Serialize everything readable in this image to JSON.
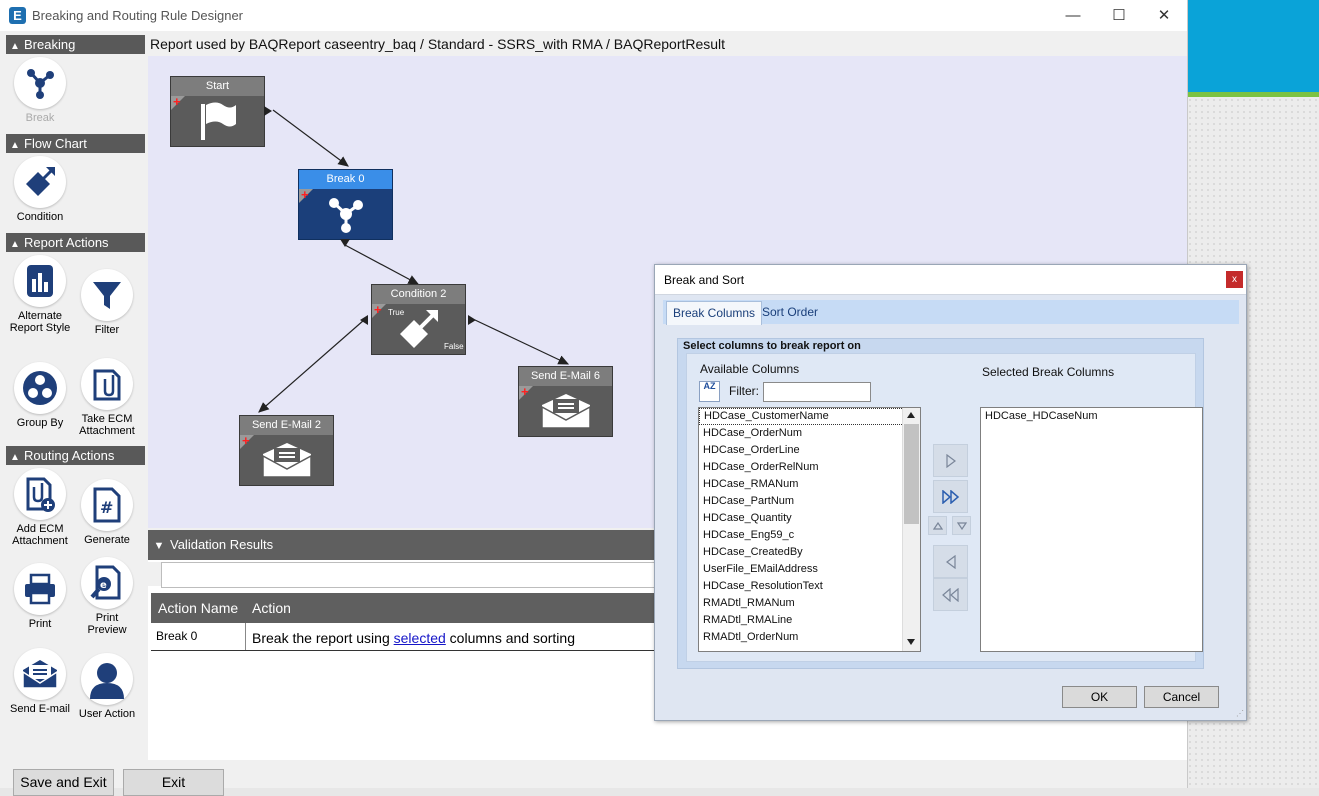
{
  "window": {
    "title": "Breaking and Routing Rule Designer",
    "app_icon": "E",
    "controls": {
      "minimize": "—",
      "maximize": "☐",
      "close": "✕"
    }
  },
  "palette": {
    "sections": [
      {
        "title": "Breaking",
        "tools": [
          {
            "label": "Break",
            "icon": "break-icon"
          }
        ]
      },
      {
        "title": "Flow Chart",
        "tools": [
          {
            "label": "Condition",
            "icon": "condition-icon"
          }
        ]
      },
      {
        "title": "Report Actions",
        "tools": [
          {
            "label": "Alternate Report Style",
            "icon": "report-style-icon"
          },
          {
            "label": "Filter",
            "icon": "filter-icon"
          },
          {
            "label": "Group By",
            "icon": "group-by-icon"
          },
          {
            "label": "Take ECM Attachment",
            "icon": "ecm-attachment-icon"
          }
        ]
      },
      {
        "title": "Routing Actions",
        "tools": [
          {
            "label": "Add ECM Attachment",
            "icon": "add-ecm-icon"
          },
          {
            "label": "Generate",
            "icon": "generate-icon"
          },
          {
            "label": "Print",
            "icon": "print-icon"
          },
          {
            "label": "Print Preview",
            "icon": "print-preview-icon"
          },
          {
            "label": "Send E-mail",
            "icon": "send-email-icon"
          },
          {
            "label": "User Action",
            "icon": "user-action-icon"
          }
        ]
      }
    ]
  },
  "header": {
    "report_line": "Report used by BAQReport caseentry_baq / Standard - SSRS_with RMA / BAQReportResult"
  },
  "flow": {
    "nodes": {
      "start": {
        "label": "Start"
      },
      "break0": {
        "label": "Break 0"
      },
      "condition2": {
        "label": "Condition 2",
        "true_label": "True",
        "false_label": "False"
      },
      "email2": {
        "label": "Send E-Mail 2"
      },
      "email6": {
        "label": "Send E-Mail 6"
      }
    },
    "colors": {
      "canvas": "#e6e6f7",
      "node": "#5b5b5b",
      "selected_node": "#1b3f7a",
      "selected_header": "#3a8ee8"
    }
  },
  "validation": {
    "title": "Validation Results",
    "columns": [
      "Action Name",
      "Action"
    ],
    "rows": [
      {
        "name": "Break 0",
        "pre": "Break the report using ",
        "link": "selected",
        "post": " columns and sorting"
      }
    ]
  },
  "footer": {
    "save_exit": "Save and Exit",
    "exit": "Exit"
  },
  "dialog": {
    "title": "Break and Sort",
    "close": "x",
    "tabs": [
      "Break Columns",
      "Sort Order"
    ],
    "active_tab": "Break Columns",
    "section_label": "Select columns to break report on",
    "available_label": "Available Columns",
    "filter_label": "Filter:",
    "filter_value": "",
    "sort_icon_text": "AZ",
    "selected_label": "Selected Break Columns",
    "available_columns": [
      "HDCase_CustomerName",
      "HDCase_OrderNum",
      "HDCase_OrderLine",
      "HDCase_OrderRelNum",
      "HDCase_RMANum",
      "HDCase_PartNum",
      "HDCase_Quantity",
      "HDCase_Eng59_c",
      "HDCase_CreatedBy",
      "UserFile_EMailAddress",
      "HDCase_ResolutionText",
      "RMADtl_RMANum",
      "RMADtl_RMALine",
      "RMADtl_OrderNum"
    ],
    "selected_columns": [
      "HDCase_HDCaseNum"
    ],
    "ok": "OK",
    "cancel": "Cancel"
  }
}
